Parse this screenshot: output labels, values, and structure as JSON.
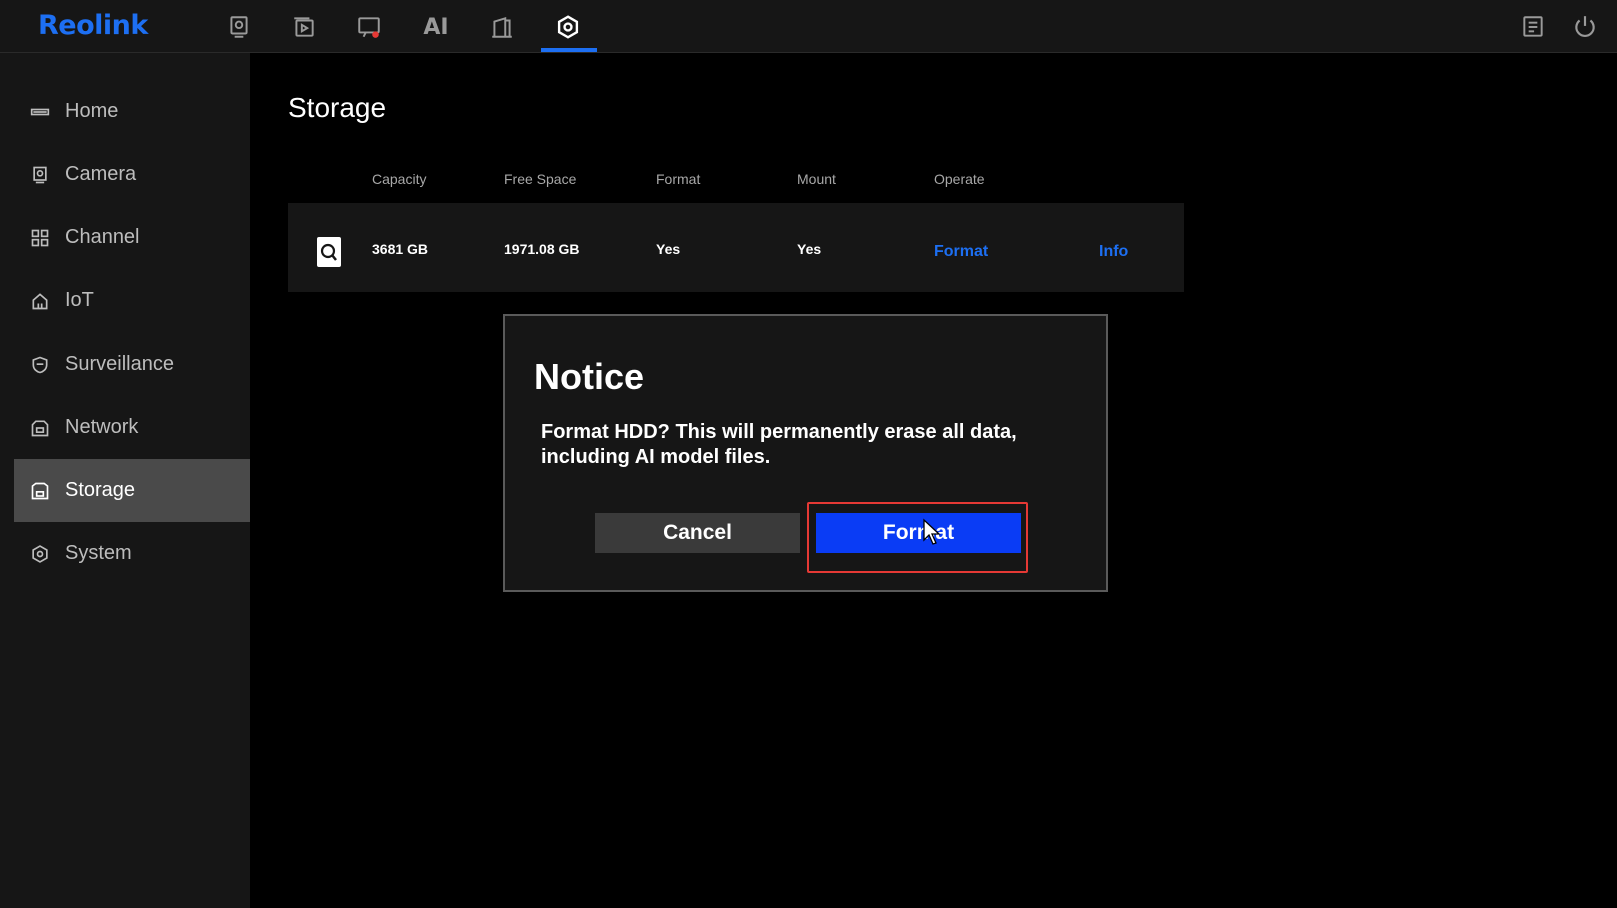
{
  "app": {
    "brand": "Reolink"
  },
  "topnav": {
    "items": [
      {
        "name": "camera-live",
        "icon": "monitor-camera-icon"
      },
      {
        "name": "playback",
        "icon": "playback-icon"
      },
      {
        "name": "alarm-camera",
        "icon": "camera-alert-icon"
      },
      {
        "name": "ai",
        "label": "AI"
      },
      {
        "name": "device",
        "icon": "device-icon"
      },
      {
        "name": "settings",
        "icon": "settings-icon",
        "active": true
      }
    ],
    "right_icons": [
      "message-icon",
      "power-icon"
    ]
  },
  "sidebar": {
    "items": [
      {
        "label": "Home",
        "icon": "home-icon"
      },
      {
        "label": "Camera",
        "icon": "camera-icon"
      },
      {
        "label": "Channel",
        "icon": "grid-icon"
      },
      {
        "label": "IoT",
        "icon": "iot-home-icon"
      },
      {
        "label": "Surveillance",
        "icon": "shield-icon"
      },
      {
        "label": "Network",
        "icon": "network-icon"
      },
      {
        "label": "Storage",
        "icon": "storage-icon",
        "active": true
      },
      {
        "label": "System",
        "icon": "system-gear-icon"
      }
    ]
  },
  "main": {
    "title": "Storage",
    "columns": {
      "capacity": "Capacity",
      "free_space": "Free Space",
      "format": "Format",
      "mount": "Mount",
      "operate": "Operate"
    },
    "disk": {
      "capacity": "3681 GB",
      "free_space": "1971.08 GB",
      "format": "Yes",
      "mount": "Yes",
      "format_action": "Format",
      "info_action": "Info"
    }
  },
  "dialog": {
    "title": "Notice",
    "message": "Format HDD? This will permanently erase all data, including AI model files.",
    "cancel_label": "Cancel",
    "confirm_label": "Format"
  },
  "colors": {
    "accent": "#1d6ff2",
    "confirm_button": "#0a3cf5",
    "highlight": "#e53935",
    "active_sidebar": "#4a4a4a"
  }
}
